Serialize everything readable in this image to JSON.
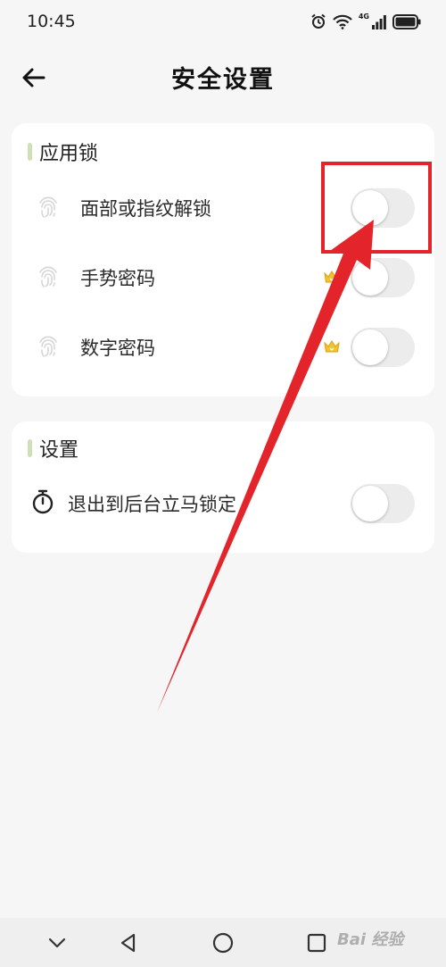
{
  "status_bar": {
    "time": "10:45",
    "network_label": "4G",
    "icons": [
      "alarm-icon",
      "wifi-icon",
      "signal-icon",
      "battery-icon"
    ]
  },
  "header": {
    "title": "安全设置",
    "back_icon": "arrow-left-icon"
  },
  "app_lock_section": {
    "title": "应用锁",
    "items": [
      {
        "label": "面部或指纹解锁",
        "icon": "fingerprint-icon",
        "enabled": false,
        "premium": false
      },
      {
        "label": "手势密码",
        "icon": "fingerprint-icon",
        "enabled": false,
        "premium": true
      },
      {
        "label": "数字密码",
        "icon": "fingerprint-icon",
        "enabled": false,
        "premium": true
      }
    ]
  },
  "settings_section": {
    "title": "设置",
    "items": [
      {
        "label": "退出到后台立马锁定",
        "icon": "timer-icon",
        "enabled": false
      }
    ]
  },
  "annotation": {
    "color": "#e3242b",
    "target": "面部或指纹解锁 toggle"
  },
  "nav_bar": {
    "buttons": [
      "chevron-down-icon",
      "back-triangle-icon",
      "home-circle-icon",
      "recents-square-icon"
    ]
  },
  "watermark": "Bai 经验",
  "colors": {
    "background": "#f6f6f6",
    "card": "#ffffff",
    "section_accent": "#cde0b8",
    "toggle_off": "#ececec",
    "crown": "#f2c230"
  }
}
